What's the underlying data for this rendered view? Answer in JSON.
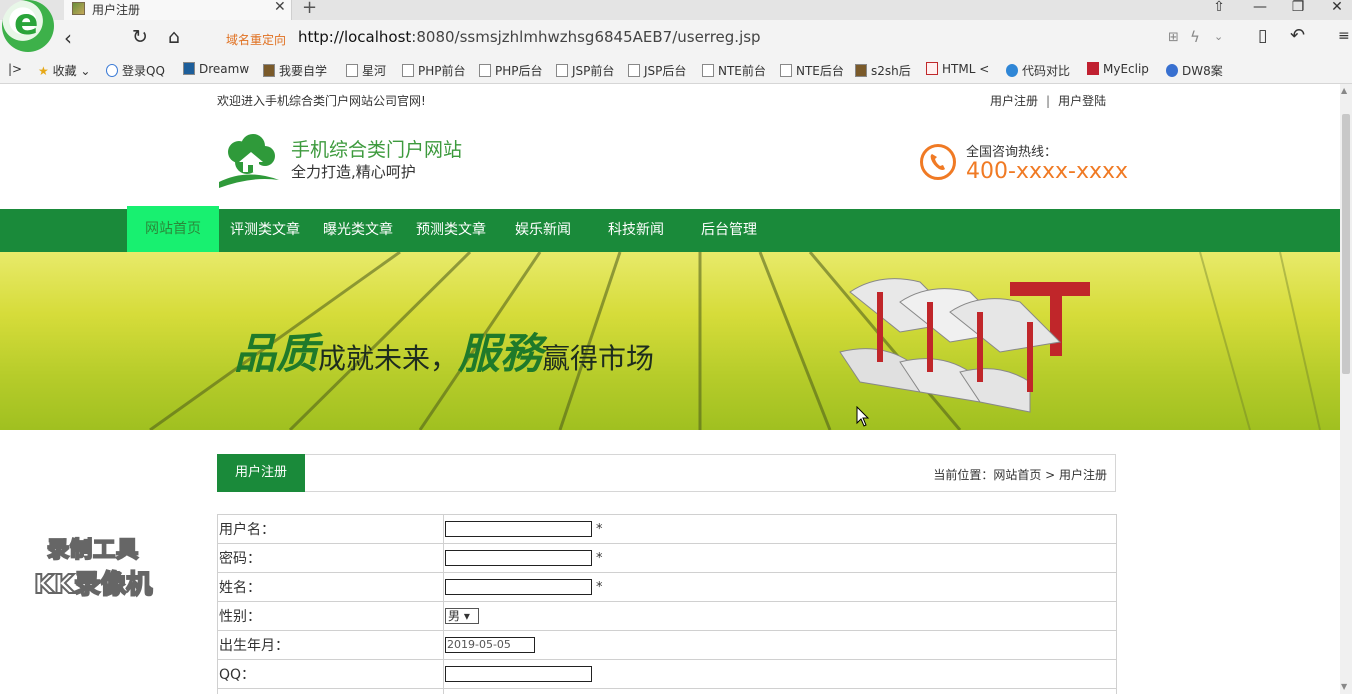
{
  "browser": {
    "tab_title": "用户注册",
    "redirect_label": "域名重定向",
    "url_host": "http://localhost",
    "url_rest": ":8080/ssmsjzhlmhwzhsg6845AEB7/userreg.jsp",
    "bookmarks": [
      "收藏",
      "登录QQ",
      "Dreamw",
      "我要自学",
      "星河",
      "PHP前台",
      "PHP后台",
      "JSP前台",
      "JSP后台",
      "NTE前台",
      "NTE后台",
      "s2sh后",
      "HTML <",
      "代码对比",
      "MyEclip",
      "DW8案"
    ]
  },
  "header": {
    "welcome": "欢迎进入手机综合类门户网站公司官网!",
    "register_link": "用户注册",
    "login_link": "用户登陆",
    "site_name": "手机综合类门户网站",
    "slogan": "全力打造,精心呵护",
    "hotline_label": "全国咨询热线：",
    "hotline_number": "400-xxxx-xxxx"
  },
  "nav": [
    "网站首页",
    "评测类文章",
    "曝光类文章",
    "预测类文章",
    "娱乐新闻",
    "科技新闻",
    "后台管理"
  ],
  "banner": {
    "word1": "品质",
    "phrase1": "成就未来，",
    "word2": "服務",
    "phrase2": "赢得市场"
  },
  "registration": {
    "tab_label": "用户注册",
    "breadcrumb": "当前位置：网站首页 > 用户注册",
    "rows": [
      {
        "label": "用户名：",
        "type": "text",
        "required": "*"
      },
      {
        "label": "密码：",
        "type": "text",
        "required": "*"
      },
      {
        "label": "姓名：",
        "type": "text",
        "required": "*"
      },
      {
        "label": "性别：",
        "type": "select",
        "value": "男"
      },
      {
        "label": "出生年月：",
        "type": "date",
        "value": "2019-05-05"
      },
      {
        "label": "QQ：",
        "type": "text"
      }
    ]
  },
  "watermark": {
    "line1": "录制工具",
    "line2": "KK录像机"
  },
  "colors": {
    "brand_green": "#1a8a3a",
    "active_nav": "#18f070",
    "hotline_orange": "#f07a24"
  }
}
